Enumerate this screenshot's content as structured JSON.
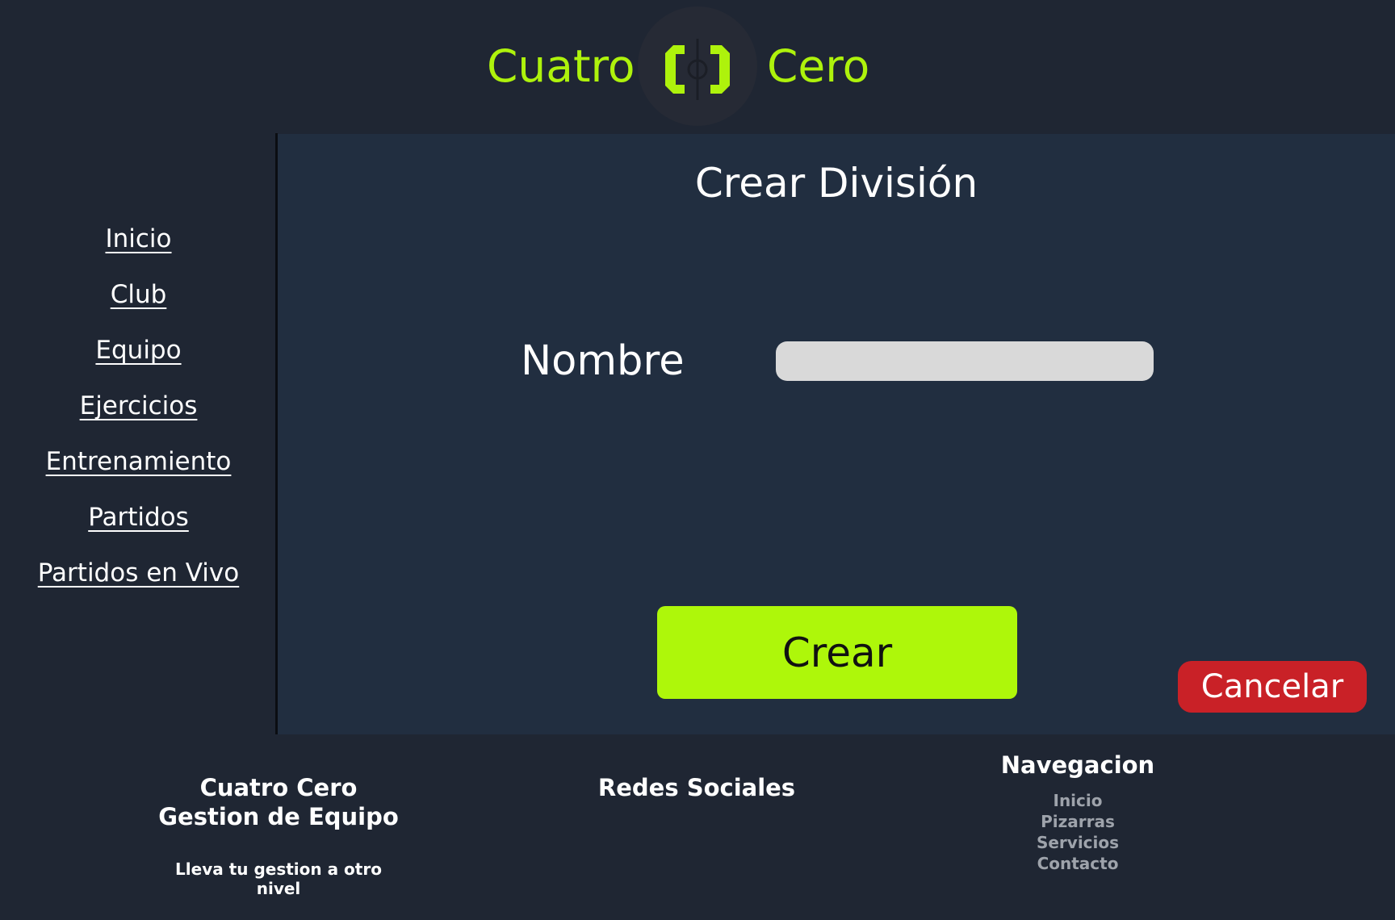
{
  "colors": {
    "accent": "#aef20c",
    "background": "#1f2633",
    "panel": "#212e40",
    "input": "#d9d9d9",
    "danger": "#c92127",
    "footer_link": "#9ea3ab"
  },
  "header": {
    "brand_left": "Cuatro",
    "brand_right": "Cero",
    "logo_icon": "bracket-circle-logo"
  },
  "sidebar": {
    "items": [
      {
        "label": "Inicio"
      },
      {
        "label": "Club"
      },
      {
        "label": "Equipo"
      },
      {
        "label": "Ejercicios"
      },
      {
        "label": "Entrenamiento"
      },
      {
        "label": "Partidos"
      },
      {
        "label": "Partidos en Vivo"
      }
    ]
  },
  "main": {
    "title": "Crear División",
    "name_label": "Nombre",
    "name_value": "",
    "name_placeholder": "",
    "create_label": "Crear",
    "cancel_label": "Cancelar"
  },
  "footer": {
    "brand_line1": "Cuatro Cero",
    "brand_line2": "Gestion de Equipo",
    "tagline": "Lleva tu gestion a otro nivel",
    "social_title": "Redes Sociales",
    "nav_title": "Navegacion",
    "nav_links": [
      "Inicio",
      "Pizarras",
      "Servicios",
      "Contacto"
    ]
  }
}
